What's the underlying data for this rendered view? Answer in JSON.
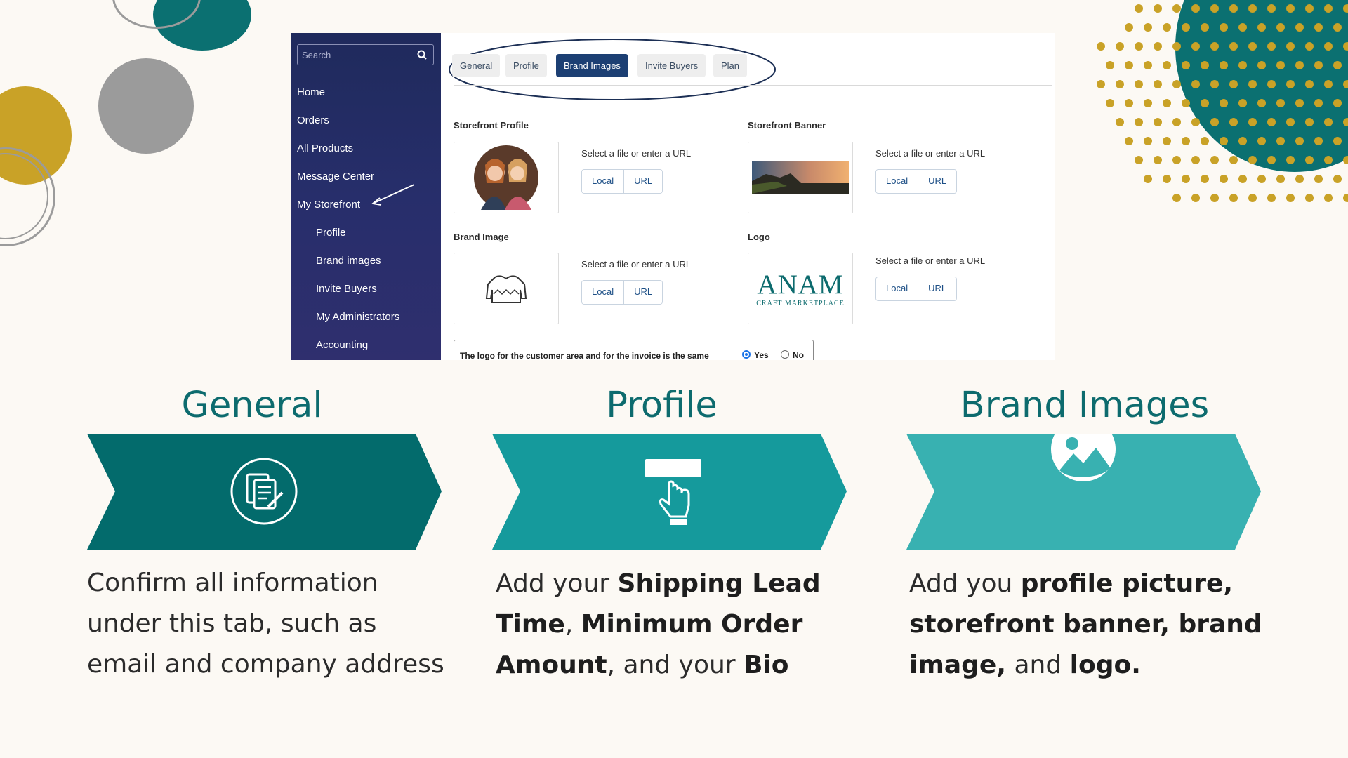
{
  "colors": {
    "teal_dark": "#036b6c",
    "teal_mid": "#159a9c",
    "teal_light": "#38b1b1",
    "mustard": "#c9a227",
    "gray": "#9b9b9b",
    "sidebar_navy": "#252c64",
    "active_tab": "#1c3f73"
  },
  "sidebar": {
    "search_placeholder": "Search",
    "items": [
      {
        "label": "Home"
      },
      {
        "label": "Orders"
      },
      {
        "label": "All Products"
      },
      {
        "label": "Message Center"
      },
      {
        "label": "My Storefront"
      },
      {
        "label": "Profile"
      },
      {
        "label": "Brand images"
      },
      {
        "label": "Invite Buyers"
      },
      {
        "label": "My Administrators"
      },
      {
        "label": "Accounting"
      }
    ]
  },
  "tabs": [
    {
      "label": "General",
      "active": false
    },
    {
      "label": "Profile",
      "active": false
    },
    {
      "label": "Brand Images",
      "active": true
    },
    {
      "label": "Invite Buyers",
      "active": false
    },
    {
      "label": "Plan",
      "active": false
    }
  ],
  "uploads": [
    {
      "title": "Storefront Profile",
      "helper": "Select a file or enter a URL",
      "local": "Local",
      "url": "URL"
    },
    {
      "title": "Storefront Banner",
      "helper": "Select a file or enter a URL",
      "local": "Local",
      "url": "URL"
    },
    {
      "title": "Brand Image",
      "helper": "Select a file or enter a URL",
      "local": "Local",
      "url": "URL"
    },
    {
      "title": "Logo",
      "helper": "Select a file or enter a URL",
      "local": "Local",
      "url": "URL"
    }
  ],
  "logo_image": {
    "name": "ANAM",
    "sub": "CRAFT MARKETPLACE"
  },
  "logo_setting": {
    "text": "The logo for the customer area and for the invoice is the same",
    "yes": "Yes",
    "no": "No",
    "selected": "Yes"
  },
  "sections": [
    {
      "heading": "General",
      "icon": "document-edit-icon",
      "desc_parts": [
        "Confirm all information under this tab, such as email and company address"
      ]
    },
    {
      "heading": "Profile",
      "icon": "click-button-icon",
      "desc_parts": [
        "Add your ",
        "Shipping Lead Time",
        ", ",
        "Minimum Order Amount",
        ", and your ",
        "Bio"
      ]
    },
    {
      "heading": "Brand Images",
      "icon": "image-icon",
      "desc_parts": [
        "Add you ",
        "profile picture, storefront banner, brand image,",
        " and ",
        "logo."
      ]
    }
  ]
}
